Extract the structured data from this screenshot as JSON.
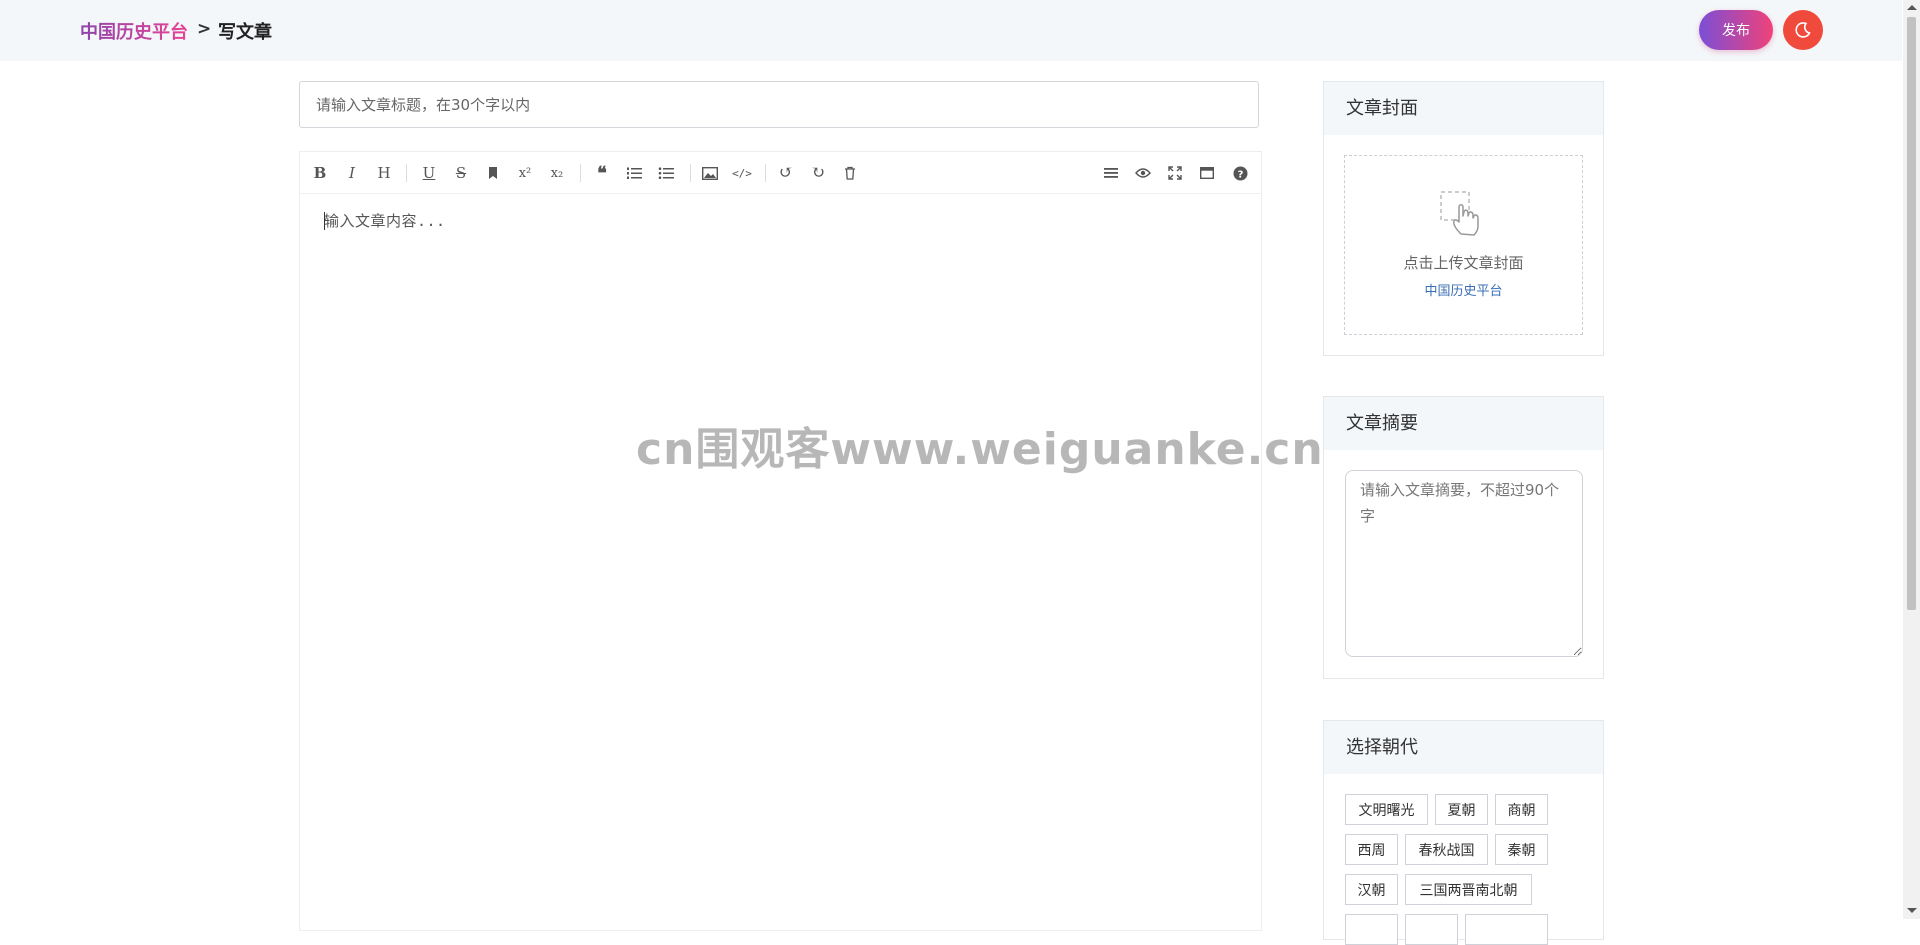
{
  "header": {
    "brand": "中国历史平台",
    "separator": ">",
    "current": "写文章",
    "publish_label": "发布"
  },
  "title_input": {
    "placeholder": "请输入文章标题，在30个字以内"
  },
  "editor": {
    "placeholder": "输入文章内容...",
    "toolbar_left": [
      "bold-icon",
      "italic-icon",
      "heading-icon",
      "underline-icon",
      "strikethrough-icon",
      "bookmark-icon",
      "superscript-icon",
      "subscript-icon",
      "quote-icon",
      "ordered-list-icon",
      "unordered-list-icon",
      "image-icon",
      "code-icon",
      "undo-icon",
      "redo-icon",
      "trash-icon"
    ],
    "toolbar_right": [
      "menu-icon",
      "preview-eye-icon",
      "fullscreen-icon",
      "window-icon",
      "help-icon"
    ]
  },
  "watermark": "cn围观客www.weiguanke.cn",
  "cover_card": {
    "title": "文章封面",
    "upload_text": "点击上传文章封面",
    "upload_sub": "中国历史平台"
  },
  "summary_card": {
    "title": "文章摘要",
    "placeholder": "请输入文章摘要，不超过90个字"
  },
  "dynasty_card": {
    "title": "选择朝代",
    "tags": [
      "文明曙光",
      "夏朝",
      "商朝",
      "西周",
      "春秋战国",
      "秦朝",
      "汉朝",
      "三国两晋南北朝"
    ]
  },
  "colors": {
    "brand_gradient_start": "#8e44ad",
    "brand_gradient_end": "#e84393",
    "publish_gradient_start": "#7b4fd6",
    "publish_gradient_end": "#f0427a",
    "moon_button": "#f04a3c",
    "link_blue": "#3a6fb5"
  }
}
